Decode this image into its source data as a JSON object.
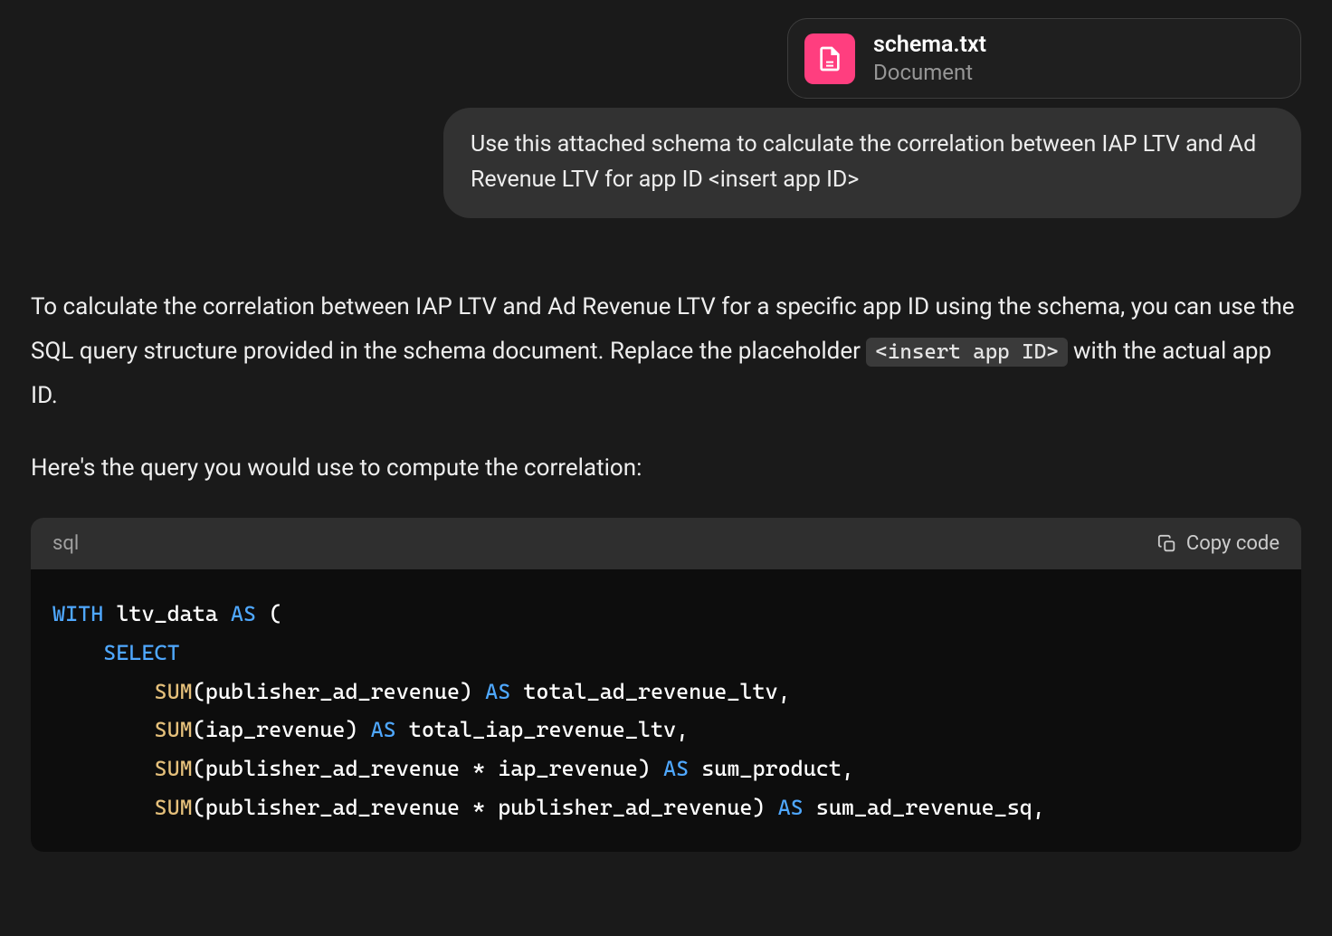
{
  "attachment": {
    "filename": "schema.txt",
    "type": "Document"
  },
  "user_message": "Use this attached schema to calculate the correlation between IAP LTV and Ad Revenue LTV for app ID <insert app ID>",
  "assistant": {
    "intro_part1": "To calculate the correlation between IAP LTV and Ad Revenue LTV for a specific app ID using the schema, you can use the SQL query structure provided in the schema document. Replace the placeholder ",
    "inline_code": "<insert app ID>",
    "intro_part2": " with the actual app ID.",
    "intro2": "Here's the query you would use to compute the correlation:",
    "code_language": "sql",
    "copy_label": "Copy code",
    "code": {
      "tokens": [
        {
          "t": "WITH",
          "cls": "kw-with"
        },
        {
          "t": " ltv_data "
        },
        {
          "t": "AS",
          "cls": "kw-as"
        },
        {
          "t": " (\n    "
        },
        {
          "t": "SELECT",
          "cls": "kw-select"
        },
        {
          "t": "\n        "
        },
        {
          "t": "SUM",
          "cls": "fn-sum"
        },
        {
          "t": "(publisher_ad_revenue) "
        },
        {
          "t": "AS",
          "cls": "kw-as"
        },
        {
          "t": " total_ad_revenue_ltv,\n        "
        },
        {
          "t": "SUM",
          "cls": "fn-sum"
        },
        {
          "t": "(iap_revenue) "
        },
        {
          "t": "AS",
          "cls": "kw-as"
        },
        {
          "t": " total_iap_revenue_ltv,\n        "
        },
        {
          "t": "SUM",
          "cls": "fn-sum"
        },
        {
          "t": "(publisher_ad_revenue * iap_revenue) "
        },
        {
          "t": "AS",
          "cls": "kw-as"
        },
        {
          "t": " sum_product,\n        "
        },
        {
          "t": "SUM",
          "cls": "fn-sum"
        },
        {
          "t": "(publisher_ad_revenue * publisher_ad_revenue) "
        },
        {
          "t": "AS",
          "cls": "kw-as"
        },
        {
          "t": " sum_ad_revenue_sq,"
        }
      ]
    }
  }
}
